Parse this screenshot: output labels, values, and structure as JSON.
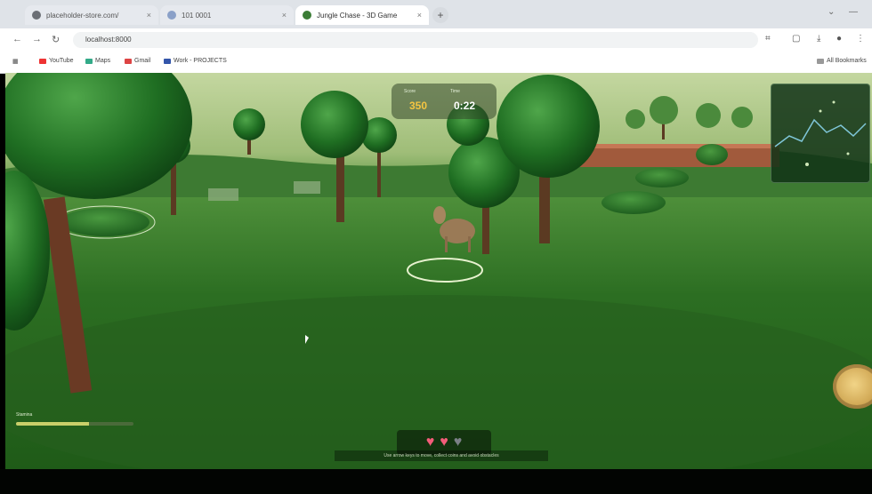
{
  "browser": {
    "tabs": [
      {
        "label": "placeholder-store.com/",
        "active": false
      },
      {
        "label": "101 0001",
        "active": false
      },
      {
        "label": "Jungle Chase - 3D Game",
        "active": true
      }
    ],
    "new_tab_label": "+",
    "window_controls": [
      "⌄",
      "—"
    ],
    "nav": {
      "back": "←",
      "forward": "→",
      "reload": "↻"
    },
    "url": "localhost:8000",
    "bookmarks": [
      "YouTube",
      "Maps",
      "Gmail",
      "Work - PROJECTS"
    ],
    "all_bookmarks_label": "All Bookmarks"
  },
  "hud": {
    "score_label": "Score",
    "score_value": "350",
    "time_label": "Time",
    "time_value": "0:22",
    "player_label": "Stamina",
    "stamina_fraction": 0.62,
    "lives": {
      "total": 3,
      "remaining": 2
    },
    "hint_text": "Use arrow keys to move, collect coins and avoid obstacles",
    "colors": {
      "score": "#f4c542",
      "time": "#ffffff",
      "heart_full": "#f45d7a",
      "heart_empty": "#7b7f86",
      "accent": "#c9cf6a"
    }
  }
}
